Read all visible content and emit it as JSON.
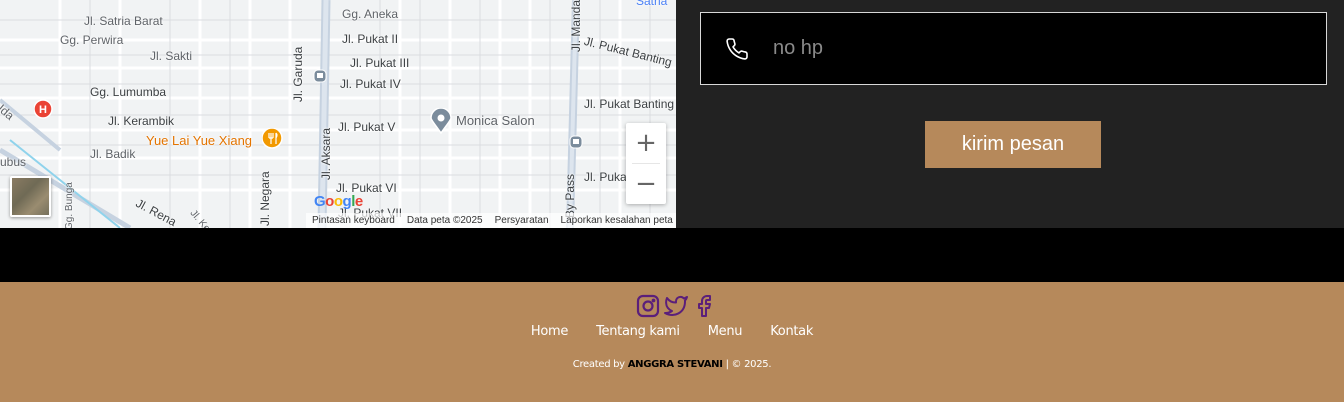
{
  "map": {
    "streets": [
      {
        "name": "Jl. Satria Barat"
      },
      {
        "name": "Gg. Aneka"
      },
      {
        "name": "Gg. Perwira"
      },
      {
        "name": "Jl. Sakti"
      },
      {
        "name": "Jl. Pukat II"
      },
      {
        "name": "Jl. Pukat III"
      },
      {
        "name": "Jl. Pukat IV"
      },
      {
        "name": "Gg. Lumumba"
      },
      {
        "name": "Jl. Kerambik"
      },
      {
        "name": "Jl. Pukat V"
      },
      {
        "name": "Jl. Badik"
      },
      {
        "name": "Jl. Pukat VI"
      },
      {
        "name": "Jl. Pukat VII"
      },
      {
        "name": "Jl. Pukat Banting"
      },
      {
        "name": "Jl. Pukat Banting"
      },
      {
        "name": "Jl. Pukat"
      },
      {
        "name": "Jl. Garuda"
      },
      {
        "name": "Jl. Aksara"
      },
      {
        "name": "Jl. Negara"
      },
      {
        "name": "Jl. Mandala"
      },
      {
        "name": "By Pass"
      },
      {
        "name": "Jl. Rena"
      },
      {
        "name": "Jl. Keris"
      },
      {
        "name": "Gg. Bunga"
      },
      {
        "name": "ubus"
      },
      {
        "name": "Uda"
      },
      {
        "name": "Satria"
      }
    ],
    "pois": {
      "restaurant": "Yue Lai Yue Xiang",
      "salon": "Monica Salon"
    },
    "zoom_in_label": "+",
    "zoom_out_label": "−",
    "attribution": {
      "keyboard": "Pintasan keyboard",
      "data": "Data peta ©2025",
      "terms": "Persyaratan",
      "report": "Laporkan kesalahan peta"
    },
    "logo": {
      "g1": "G",
      "o1": "o",
      "o2": "o",
      "g2": "g",
      "l": "l",
      "e": "e"
    }
  },
  "form": {
    "phone_placeholder": "no hp",
    "submit_label": "kirim pesan"
  },
  "footer": {
    "social_icons": [
      "instagram-icon",
      "twitter-icon",
      "facebook-icon"
    ],
    "nav": [
      "Home",
      "Tentang kami",
      "Menu",
      "Kontak"
    ],
    "credit_prefix": "Created by",
    "credit_name": "ANGGRA STEVANI",
    "credit_suffix": "| © 2025."
  },
  "colors": {
    "accent": "#b6895b",
    "icon_purple": "#5b1f7a",
    "form_bg": "#222222"
  }
}
